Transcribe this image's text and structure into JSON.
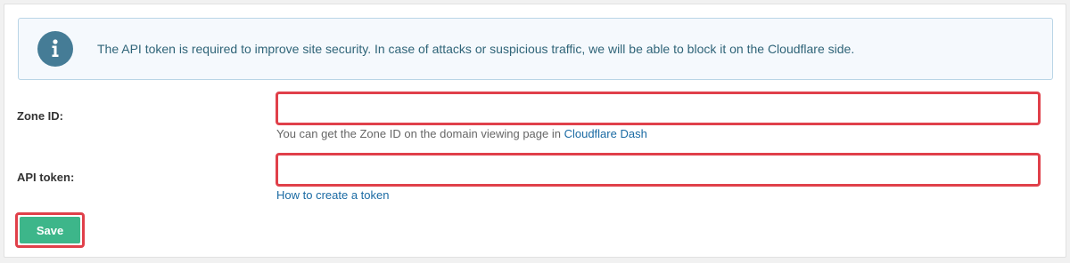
{
  "notice": {
    "icon": "info-icon",
    "text": "The API token is required to improve site security. In case of attacks or suspicious traffic, we will be able to block it on the Cloudflare side."
  },
  "zone_id": {
    "label": "Zone ID:",
    "value": "",
    "help_text": "You can get the Zone ID on the domain viewing page in ",
    "help_link": "Cloudflare Dash"
  },
  "api_token": {
    "label": "API token:",
    "value": "",
    "help_link": "How to create a token"
  },
  "actions": {
    "save_label": "Save"
  },
  "colors": {
    "accent_green": "#3db68a",
    "highlight_red": "#e0404a",
    "link_blue": "#1a6aa3",
    "info_icon": "#457c96"
  }
}
